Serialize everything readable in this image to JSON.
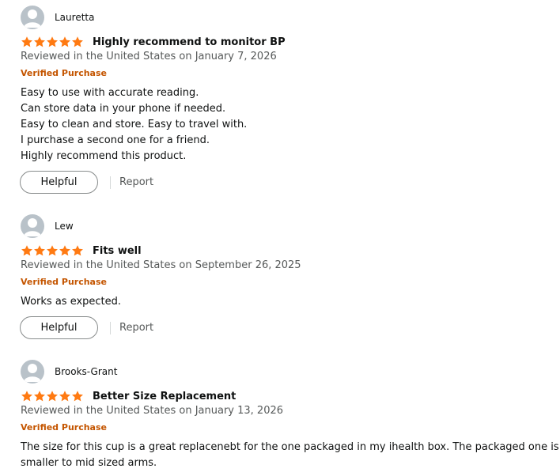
{
  "icons": {
    "avatar": "user-silhouette-icon",
    "star": "star-icon"
  },
  "colors": {
    "star": "#ff7a12",
    "verified": "#c45500",
    "meta": "#565959",
    "text": "#0f1111"
  },
  "reviews": [
    {
      "author": "Lauretta",
      "rating": 5,
      "title": "Highly recommend to monitor BP",
      "meta": "Reviewed in the United States on January 7, 2026",
      "verified": "Verified Purchase",
      "body": [
        "Easy to use with accurate reading.",
        "Can store data in your phone if needed.",
        "Easy to clean and store. Easy to travel with.",
        "I purchase a second one for a friend.",
        "Highly recommend this product."
      ],
      "helpful_label": "Helpful",
      "report_label": "Report"
    },
    {
      "author": "Lew",
      "rating": 5,
      "title": "Fits well",
      "meta": "Reviewed in the United States on September 26, 2025",
      "verified": "Verified Purchase",
      "body": [
        "Works as expected."
      ],
      "helpful_label": "Helpful",
      "report_label": "Report"
    },
    {
      "author": "Brooks-Grant",
      "rating": 5,
      "title": "Better Size Replacement",
      "meta": "Reviewed in the United States on January 13, 2026",
      "verified": "Verified Purchase",
      "body": [
        "The size for this cup is a great replacenebt for the one packaged in my ihealth box. The packaged one is for",
        "smaller to mid sized arms."
      ]
    }
  ]
}
